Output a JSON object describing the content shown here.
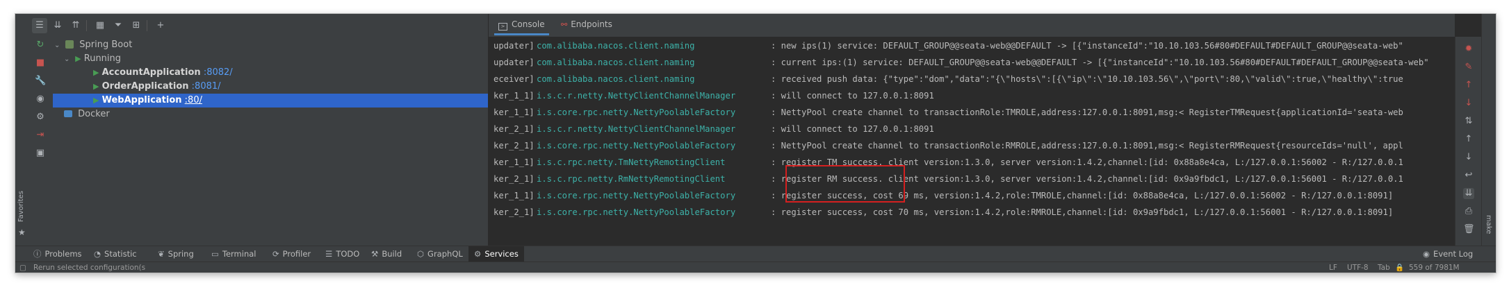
{
  "services": {
    "tree": {
      "root": "Spring Boot",
      "group": "Running",
      "apps": [
        {
          "name": "AccountApplication",
          "port": ":8082/"
        },
        {
          "name": "OrderApplication",
          "port": ":8081/"
        },
        {
          "name": "WebApplication",
          "port": ":80/"
        }
      ],
      "docker": "Docker"
    }
  },
  "console": {
    "tabs": [
      {
        "label": "Console",
        "icon": "console-icon"
      },
      {
        "label": "Endpoints",
        "icon": "endpoints-icon"
      }
    ],
    "lines": [
      {
        "thread": "updater]",
        "cls": "com.alibaba.nacos.client.naming",
        "msg": ": new ips(1) service: DEFAULT_GROUP@@seata-web@@DEFAULT -> [{\"instanceId\":\"10.10.103.56#80#DEFAULT#DEFAULT_GROUP@@seata-web\""
      },
      {
        "thread": "updater]",
        "cls": "com.alibaba.nacos.client.naming",
        "msg": ": current ips:(1) service: DEFAULT_GROUP@@seata-web@@DEFAULT -> [{\"instanceId\":\"10.10.103.56#80#DEFAULT#DEFAULT_GROUP@@seata-web\""
      },
      {
        "thread": "eceiver]",
        "cls": "com.alibaba.nacos.client.naming",
        "msg": ": received push data: {\"type\":\"dom\",\"data\":\"{\\\"hosts\\\":[{\\\"ip\\\":\\\"10.10.103.56\\\",\\\"port\\\":80,\\\"valid\\\":true,\\\"healthy\\\":true"
      },
      {
        "thread": "ker_1_1]",
        "cls": "i.s.c.r.netty.NettyClientChannelManager",
        "msg": ": will connect to 127.0.0.1:8091"
      },
      {
        "thread": "ker_1_1]",
        "cls": "i.s.core.rpc.netty.NettyPoolableFactory",
        "msg": ": NettyPool create channel to transactionRole:TMROLE,address:127.0.0.1:8091,msg:< RegisterTMRequest{applicationId='seata-web"
      },
      {
        "thread": "ker_2_1]",
        "cls": "i.s.c.r.netty.NettyClientChannelManager",
        "msg": ": will connect to 127.0.0.1:8091"
      },
      {
        "thread": "ker_2_1]",
        "cls": "i.s.core.rpc.netty.NettyPoolableFactory",
        "msg": ": NettyPool create channel to transactionRole:RMROLE,address:127.0.0.1:8091,msg:< RegisterRMRequest{resourceIds='null', appl"
      },
      {
        "thread": "ker_1_1]",
        "cls": "i.s.c.rpc.netty.TmNettyRemotingClient",
        "msg": ": register TM success. client version:1.3.0, server version:1.4.2,channel:[id: 0x88a8e4ca, L:/127.0.0.1:56002 - R:/127.0.0.1"
      },
      {
        "thread": "ker_2_1]",
        "cls": "i.s.c.rpc.netty.RmNettyRemotingClient",
        "msg": ": register RM success. client version:1.3.0, server version:1.4.2,channel:[id: 0x9a9fbdc1, L:/127.0.0.1:56001 - R:/127.0.0.1"
      },
      {
        "thread": "ker_1_1]",
        "cls": "i.s.core.rpc.netty.NettyPoolableFactory",
        "msg": ": register success, cost 69 ms, version:1.4.2,role:TMROLE,channel:[id: 0x88a8e4ca, L:/127.0.0.1:56002 - R:/127.0.0.1:8091]"
      },
      {
        "thread": "ker_2_1]",
        "cls": "i.s.core.rpc.netty.NettyPoolableFactory",
        "msg": ": register success, cost 70 ms, version:1.4.2,role:RMROLE,channel:[id: 0x9a9fbdc1, L:/127.0.0.1:56001 - R:/127.0.0.1:8091]"
      }
    ]
  },
  "left_strip": {
    "favorites": "Favorites"
  },
  "right_strip": {
    "make": "make"
  },
  "bottom_tabs": [
    {
      "label": "Problems",
      "icon": "problems-icon"
    },
    {
      "label": "Statistic",
      "icon": "statistic-icon"
    },
    {
      "label": "Spring",
      "icon": "spring-icon"
    },
    {
      "label": "Terminal",
      "icon": "terminal-icon"
    },
    {
      "label": "Profiler",
      "icon": "profiler-icon"
    },
    {
      "label": "TODO",
      "icon": "todo-icon"
    },
    {
      "label": "Build",
      "icon": "build-icon"
    },
    {
      "label": "GraphQL",
      "icon": "graphql-icon"
    },
    {
      "label": "Services",
      "icon": "services-icon",
      "active": true
    }
  ],
  "event_log": "Event Log",
  "status": {
    "message": "Rerun selected configuration(s",
    "line_sep": "LF",
    "encoding": "UTF-8",
    "indent": "Tab",
    "memory": "559 of 7981M"
  },
  "colors": {
    "selection": "#2f65ca",
    "highlight_box": "#d52020",
    "class_name": "#3db2a9"
  }
}
